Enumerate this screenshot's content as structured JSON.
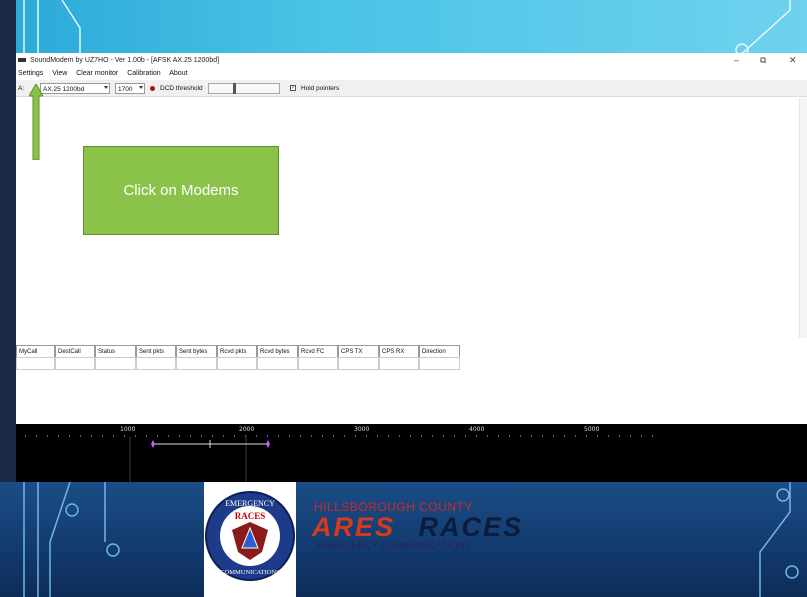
{
  "window": {
    "title": "SoundModem by UZ7HO - Ver 1.00b - [AFSK AX.25 1200bd]",
    "controls": {
      "minimize": "–",
      "restore": "⧉",
      "close": "✕"
    }
  },
  "menu": {
    "items": [
      "Settings",
      "View",
      "Clear monitor",
      "Calibration",
      "About"
    ]
  },
  "toolbar": {
    "channel_label": "A:",
    "modem_value": "AX.25 1200bd",
    "frequency_value": "1700",
    "dcd_label": "DCD threshold",
    "hold_pointers_label": "Hold pointers",
    "hold_pointers_checked": true
  },
  "table": {
    "columns": [
      "MyCall",
      "DestCall",
      "Status",
      "Sent pkts",
      "Sent bytes",
      "Rcvd pkts",
      "Rcvd bytes",
      "Rcvd FC",
      "CPS TX",
      "CPS RX",
      "Direction"
    ]
  },
  "spectrum": {
    "ticks": [
      "1000",
      "2000",
      "3000",
      "4000",
      "5000"
    ]
  },
  "callout": {
    "text": "Click on Modems"
  },
  "banner": {
    "org_top": "HILLSBOROUGH COUNTY",
    "ares": "ARES",
    "races": "RACES",
    "subtitle": "EMERGENCY COMMUNICATIONS",
    "emblem_top": "EMERGENCY",
    "emblem_mid": "RACES",
    "emblem_bottom": "COMMUNICATIONS"
  },
  "colors": {
    "callout_bg": "#8bc34a",
    "banner_blue": "#1b4d86",
    "ares_red": "#d63a1c",
    "top_band": "#4ac3e6"
  }
}
